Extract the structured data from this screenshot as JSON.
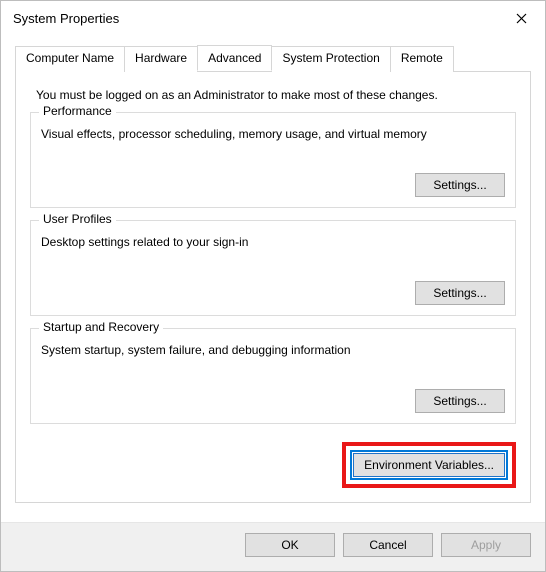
{
  "window": {
    "title": "System Properties"
  },
  "tabs": {
    "computer_name": "Computer Name",
    "hardware": "Hardware",
    "advanced": "Advanced",
    "system_protection": "System Protection",
    "remote": "Remote"
  },
  "intro": "You must be logged on as an Administrator to make most of these changes.",
  "groups": {
    "performance": {
      "title": "Performance",
      "desc": "Visual effects, processor scheduling, memory usage, and virtual memory",
      "button": "Settings..."
    },
    "user_profiles": {
      "title": "User Profiles",
      "desc": "Desktop settings related to your sign-in",
      "button": "Settings..."
    },
    "startup_recovery": {
      "title": "Startup and Recovery",
      "desc": "System startup, system failure, and debugging information",
      "button": "Settings..."
    }
  },
  "env_button": "Environment Variables...",
  "footer": {
    "ok": "OK",
    "cancel": "Cancel",
    "apply": "Apply"
  }
}
